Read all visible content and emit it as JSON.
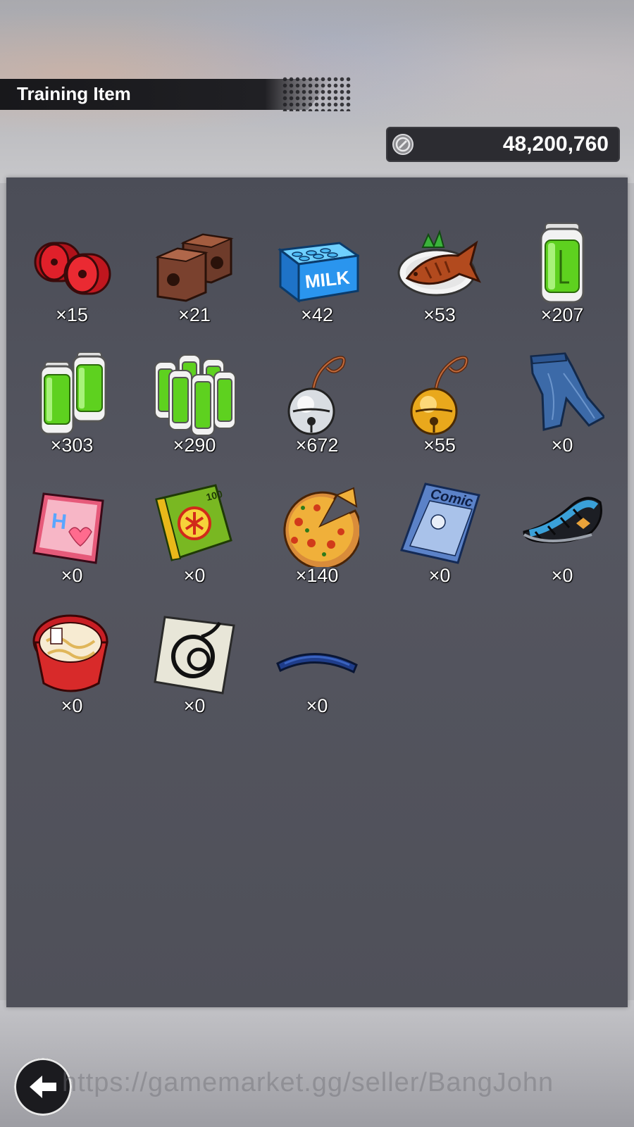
{
  "header": {
    "title": "Training Item"
  },
  "currency": {
    "icon": "coin-icon",
    "value": "48,200,760"
  },
  "items": [
    {
      "icon": "red-weights-icon",
      "count": "×15"
    },
    {
      "icon": "brick-weights-icon",
      "count": "×21"
    },
    {
      "icon": "milk-carton-icon",
      "count": "×42"
    },
    {
      "icon": "grilled-fish-icon",
      "count": "×53"
    },
    {
      "icon": "battery-icon",
      "count": "×207"
    },
    {
      "icon": "battery-pair-icon",
      "count": "×303"
    },
    {
      "icon": "battery-pack-icon",
      "count": "×290"
    },
    {
      "icon": "silver-bell-icon",
      "count": "×672"
    },
    {
      "icon": "gold-bell-icon",
      "count": "×55"
    },
    {
      "icon": "jeans-icon",
      "count": "×0"
    },
    {
      "icon": "pink-magazine-icon",
      "count": "×0"
    },
    {
      "icon": "test-book-icon",
      "count": "×0"
    },
    {
      "icon": "pizza-icon",
      "count": "×140"
    },
    {
      "icon": "comic-book-icon",
      "count": "×0"
    },
    {
      "icon": "sandal-icon",
      "count": "×0"
    },
    {
      "icon": "ramen-cup-icon",
      "count": "×0"
    },
    {
      "icon": "whis-symbol-card-icon",
      "count": "×0"
    },
    {
      "icon": "blue-headband-icon",
      "count": "×0"
    }
  ],
  "footer": {
    "back_icon": "back-arrow-icon",
    "watermark": "https://gamemarket.gg/seller/BangJohn"
  }
}
